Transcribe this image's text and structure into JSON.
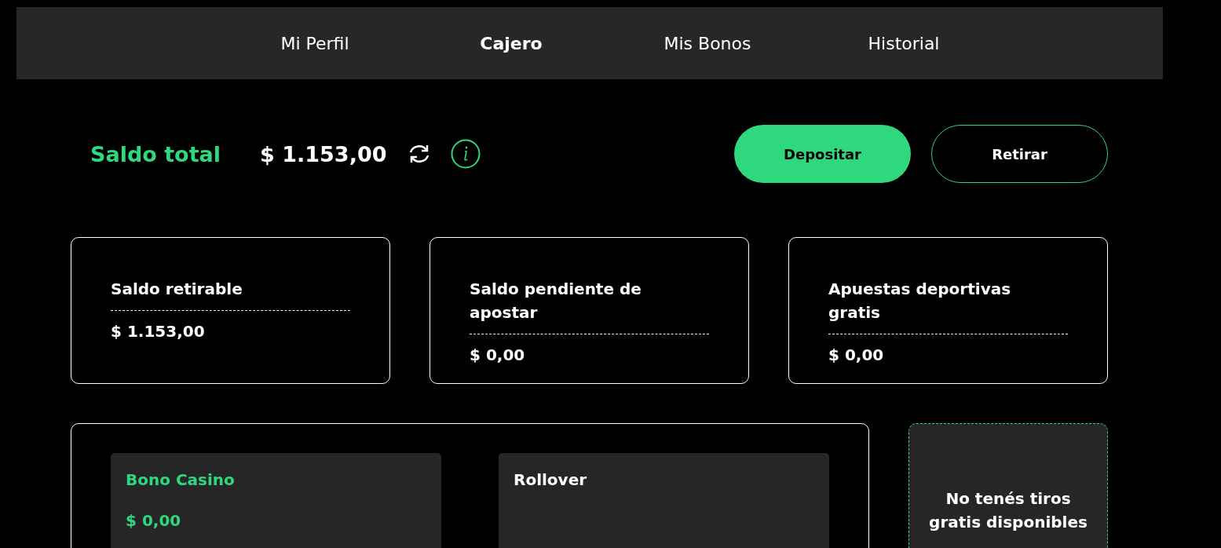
{
  "tabs": [
    {
      "label": "Mi Perfil",
      "selected": false
    },
    {
      "label": "Cajero",
      "selected": true
    },
    {
      "label": "Mis Bonos",
      "selected": false
    },
    {
      "label": "Historial",
      "selected": false
    }
  ],
  "balance": {
    "label": "Saldo total",
    "amount": "$ 1.153,00"
  },
  "actions": [
    {
      "label": "Depositar",
      "kind": "primary"
    },
    {
      "label": "Retirar",
      "kind": "outline"
    }
  ],
  "balance_cards": [
    {
      "label": "Saldo retirable",
      "amount": "$ 1.153,00"
    },
    {
      "label": "Saldo pendiente de apostar",
      "amount": "$ 0,00"
    },
    {
      "label": "Apuestas deportivas gratis",
      "amount": "$ 0,00"
    }
  ],
  "bonus_tiles": [
    {
      "title": "Bono Casino",
      "amount": "$ 0,00",
      "highlighted": true
    },
    {
      "title": "Rollover",
      "highlighted": false
    }
  ],
  "free_spins": {
    "message": "No tenés tiros gratis disponibles"
  }
}
